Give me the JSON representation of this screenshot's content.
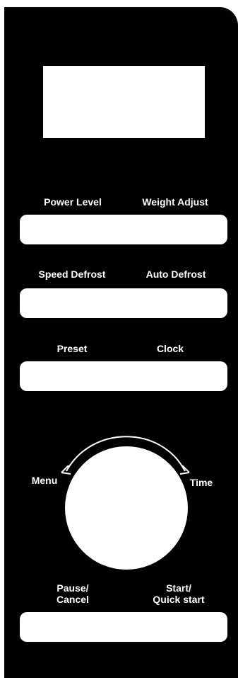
{
  "panel": {
    "display": {
      "reading": ""
    },
    "rows": [
      {
        "left_label": "Power  Level",
        "right_label": "Weight Adjust"
      },
      {
        "left_label": "Speed Defrost",
        "right_label": "Auto Defrost"
      },
      {
        "left_label": "Preset",
        "right_label": "Clock"
      }
    ],
    "dial": {
      "left_label": "Menu",
      "right_label": "Time"
    },
    "bottom": {
      "left_label_line1": "Pause/",
      "left_label_line2": "Cancel",
      "right_label_line1": "Start/",
      "right_label_line2": "Quick start"
    }
  },
  "colors": {
    "panel": "#000000",
    "controls": "#ffffff",
    "text": "#ffffff"
  }
}
